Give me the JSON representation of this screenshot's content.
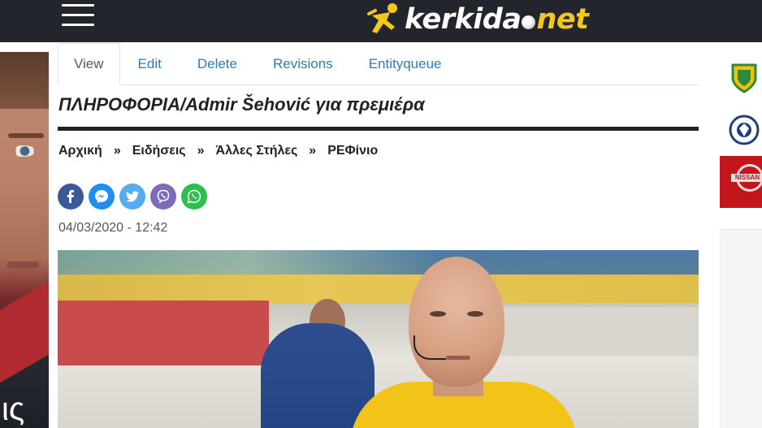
{
  "header": {
    "logo_main": "kerkida",
    "logo_suffix": "net",
    "colors": {
      "background": "#23252d",
      "accent": "#f4c81b"
    },
    "menu_icon": "hamburger-menu-icon"
  },
  "left_ad": {
    "text": "ις"
  },
  "tabs": [
    {
      "label": "View",
      "active": true
    },
    {
      "label": "Edit",
      "active": false
    },
    {
      "label": "Delete",
      "active": false
    },
    {
      "label": "Revisions",
      "active": false
    },
    {
      "label": "Entityqueue",
      "active": false
    }
  ],
  "article": {
    "title": "ΠΛΗΡΟΦΟΡΙΑ/Admir Šehović για πρεμιέρα",
    "breadcrumb": [
      "Αρχική",
      "Ειδήσεις",
      "Άλλες Στήλες",
      "ΡΕΦίνιο"
    ],
    "breadcrumb_separator": "»",
    "datetime": "04/03/2020 - 12:42"
  },
  "share": [
    {
      "network": "facebook",
      "icon": "facebook-icon",
      "color": "#3b5998"
    },
    {
      "network": "messenger",
      "icon": "messenger-icon",
      "color": "#1f8ef1"
    },
    {
      "network": "twitter",
      "icon": "twitter-icon",
      "color": "#55acee"
    },
    {
      "network": "viber",
      "icon": "viber-icon",
      "color": "#7d6ab9"
    },
    {
      "network": "whatsapp",
      "icon": "whatsapp-icon",
      "color": "#2fbf4f"
    }
  ],
  "right_ad": {
    "brand_text": "NISSAN"
  },
  "colors": {
    "link": "#2e7bb9",
    "title": "#222222"
  }
}
